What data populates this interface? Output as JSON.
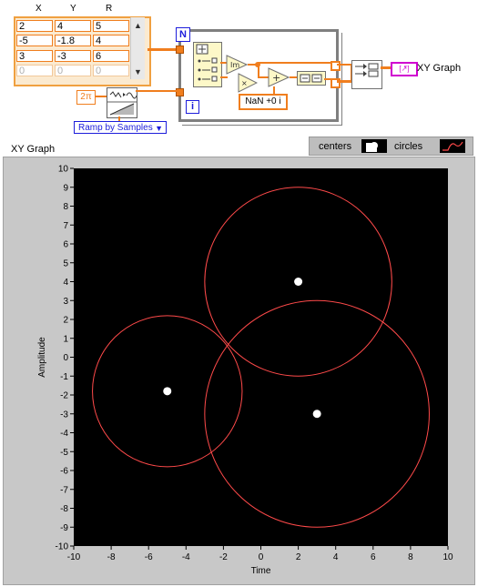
{
  "table": {
    "headers": [
      "X",
      "Y",
      "R"
    ],
    "rows": [
      [
        "2",
        "4",
        "5"
      ],
      [
        "-5",
        "-1.8",
        "4"
      ],
      [
        "3",
        "-3",
        "6"
      ]
    ],
    "placeholder_row": [
      "0",
      "0",
      "0"
    ],
    "scroll_up": "▲",
    "scroll_down": "▼"
  },
  "diagram": {
    "loop_count_label": "N",
    "loop_index_label": "i",
    "constant_2pi": "2π",
    "complex_constant": "NaN +0 i",
    "ramp_selector": "Ramp by Samples",
    "ramp_arrow": "▼",
    "graph_terminal": "XY Graph"
  },
  "graph": {
    "title": "XY Graph",
    "legend": {
      "centers_label": "centers",
      "circles_label": "circles"
    },
    "colors": {
      "plot_bg": "#000000",
      "circle": "#ff4a4a",
      "center": "#ffffff",
      "panel": "#c8c8c8"
    }
  },
  "chart_data": {
    "type": "scatter",
    "xlabel": "Time",
    "ylabel": "Amplitude",
    "xlim": [
      -10,
      10
    ],
    "ylim": [
      -10,
      10
    ],
    "x_ticks": [
      -10,
      -8,
      -6,
      -4,
      -2,
      0,
      2,
      4,
      6,
      8,
      10
    ],
    "y_ticks": [
      10,
      9,
      8,
      7,
      6,
      5,
      4,
      3,
      2,
      1,
      0,
      -1,
      -2,
      -3,
      -4,
      -5,
      -6,
      -7,
      -8,
      -9,
      -10
    ],
    "series": [
      {
        "name": "centers",
        "points": [
          [
            2,
            4
          ],
          [
            -5,
            -1.8
          ],
          [
            3,
            -3
          ]
        ]
      },
      {
        "name": "circles",
        "circles": [
          [
            2,
            4,
            5
          ],
          [
            -5,
            -1.8,
            4
          ],
          [
            3,
            -3,
            6
          ]
        ]
      }
    ],
    "legend_placement": "top-right",
    "grid": false
  }
}
